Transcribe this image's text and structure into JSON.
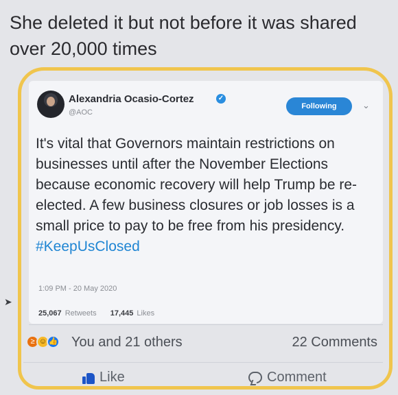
{
  "post": {
    "caption": "She deleted it but not before it was shared over 20,000 times"
  },
  "tweet": {
    "author_name": "Alexandria Ocasio-Cortez",
    "handle": "@AOC",
    "follow_label": "Following",
    "text": "It's vital that Governors maintain restrictions on businesses until after the November Elections because economic recovery will help Trump be re-elected. A few business closures or job losses is a small price to pay to be free from his presidency.",
    "hashtag": "#KeepUsClosed",
    "timestamp": "1:09 PM - 20 May 2020",
    "retweets_count": "25,067",
    "retweets_label": "Retweets",
    "likes_count": "17,445",
    "likes_label": "Likes"
  },
  "reactions": {
    "icons": [
      "angry-reaction-icon",
      "haha-reaction-icon",
      "like-reaction-icon"
    ],
    "summary": "You and 21 others",
    "comments_count": "22 Comments"
  },
  "actions": {
    "like_label": "Like",
    "comment_label": "Comment"
  },
  "colors": {
    "highlight": "#f0c54d",
    "follow_button": "#2a86d6",
    "hashtag": "#1f85d3",
    "like_icon": "#1c55c7"
  }
}
